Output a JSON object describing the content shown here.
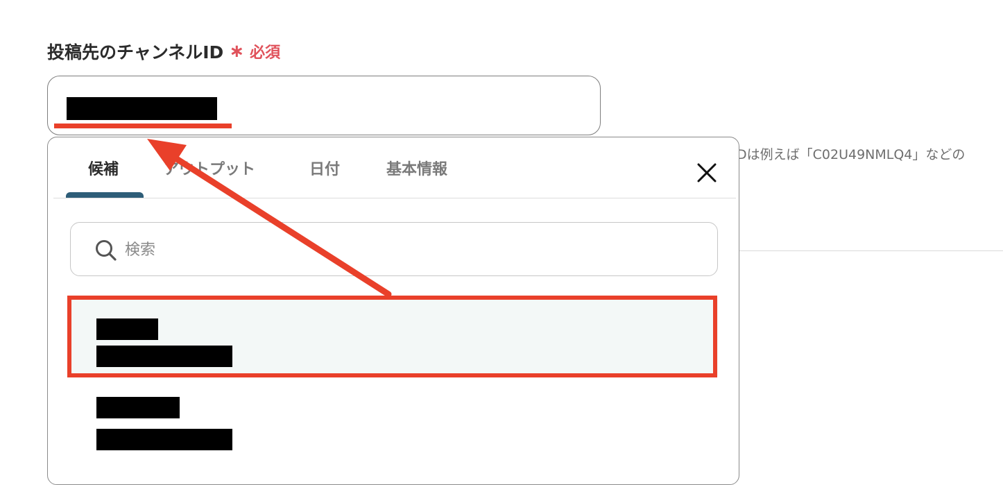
{
  "field": {
    "label": "投稿先のチャンネルID",
    "required_mark": "∗",
    "required_text": "必須",
    "value": "[redacted]"
  },
  "hint": {
    "text": "Dは例えば「C02U49NMLQ4」などの"
  },
  "popup": {
    "tabs": [
      {
        "label": "候補",
        "active": true
      },
      {
        "label": "アウトプット",
        "active": false
      },
      {
        "label": "日付",
        "active": false
      },
      {
        "label": "基本情報",
        "active": false
      }
    ],
    "close_icon": "close-icon",
    "search": {
      "placeholder": "検索",
      "value": "",
      "icon": "search-icon"
    },
    "options": [
      {
        "name": "[redacted]",
        "id": "[redacted]",
        "selected": true
      },
      {
        "name": "[redacted]",
        "id": "[redacted]",
        "selected": false
      }
    ]
  },
  "annotation": {
    "color": "#e9402a"
  },
  "colors": {
    "required": "#e0525b",
    "tab_underline": "#2e5d78",
    "selected_row": "#f3f8f7"
  }
}
